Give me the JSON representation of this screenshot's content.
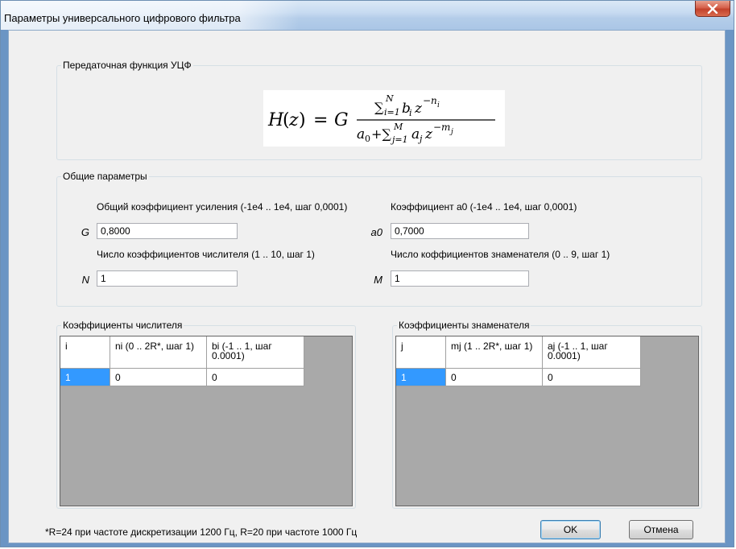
{
  "window": {
    "title": "Параметры универсального цифрового фильтра"
  },
  "transfer_group": {
    "title": "Передаточная функция УЦФ",
    "formula_lhs": "H(z) = G",
    "numerator": "∑ b_i z^(−n_i), i=1..N",
    "denominator": "a0 + ∑ a_j z^(−m_j), j=1..M"
  },
  "general_group": {
    "title": "Общие параметры",
    "gain": {
      "label": "Общий коэффициент усиления (-1e4 .. 1e4, шаг 0,0001)",
      "symbol": "G",
      "value": "0,8000"
    },
    "a0": {
      "label": "Коэффициент a0 (-1e4 .. 1e4, шаг 0,0001)",
      "symbol": "a0",
      "value": "0,7000"
    },
    "n_count": {
      "label": "Число коэффициентов числителя (1 .. 10, шаг 1)",
      "symbol": "N",
      "value": "1"
    },
    "m_count": {
      "label": "Число коффициентов знаменателя (0 .. 9, шаг 1)",
      "symbol": "M",
      "value": "1"
    }
  },
  "numerator_group": {
    "title": "Коэффициенты числителя",
    "columns": [
      "i",
      "ni (0 .. 2R*, шаг 1)",
      "bi (-1 .. 1, шаг 0.0001)"
    ],
    "rows": [
      [
        "1",
        "0",
        "0"
      ]
    ]
  },
  "denominator_group": {
    "title": "Коэффициенты знаменателя",
    "columns": [
      "j",
      "mj (1 .. 2R*, шаг 1)",
      "aj (-1 .. 1, шаг 0.0001)"
    ],
    "rows": [
      [
        "1",
        "0",
        "0"
      ]
    ]
  },
  "footnote": "*R=24 при частоте дискретизации 1200 Гц, R=20 при частоте 1000 Гц",
  "buttons": {
    "ok": "OK",
    "cancel": "Отмена"
  },
  "colors": {
    "selection": "#3399ff",
    "grid_background": "#a9a9a9",
    "client_background": "#f0f0f0"
  }
}
